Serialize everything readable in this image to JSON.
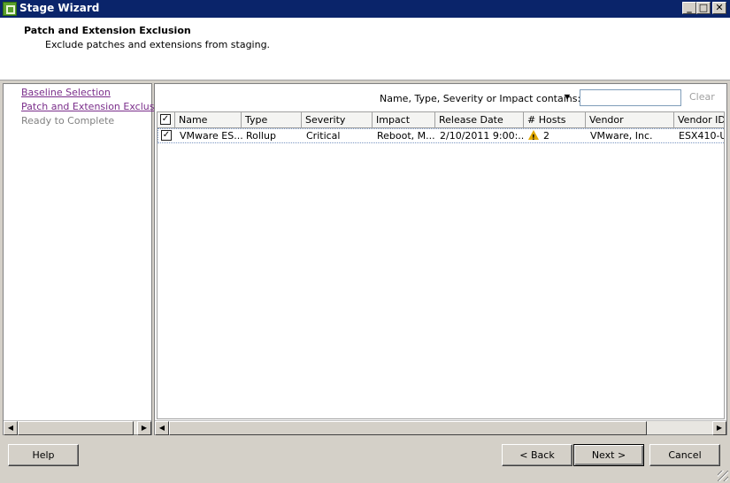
{
  "window": {
    "title": "Stage Wizard",
    "min_glyph": "_",
    "max_glyph": "□",
    "close_glyph": "✕"
  },
  "header": {
    "title": "Patch and Extension Exclusion",
    "subtitle": "Exclude patches and extensions from staging."
  },
  "nav": {
    "items": [
      {
        "label": "Baseline Selection",
        "state": "link"
      },
      {
        "label": "Patch and Extension Exclusion",
        "state": "link"
      },
      {
        "label": "Ready to Complete",
        "state": "disabled"
      }
    ]
  },
  "filter": {
    "label": "Name, Type, Severity or Impact contains:",
    "value": "",
    "clear_label": "Clear"
  },
  "grid": {
    "columns": [
      "Name",
      "Type",
      "Severity",
      "Impact",
      "Release Date",
      "# Hosts",
      "Vendor",
      "Vendor ID"
    ],
    "rows": [
      {
        "checked": true,
        "name": "VMware ES...",
        "type": "Rollup",
        "severity": "Critical",
        "impact": "Reboot, M...",
        "release_date": "2/10/2011 9:00:...",
        "hosts": "2",
        "hosts_icon": "warning-icon",
        "vendor": "VMware, Inc.",
        "vendor_id": "ESX410-U..."
      }
    ]
  },
  "buttons": {
    "help": "Help",
    "back": "< Back",
    "next": "Next >",
    "cancel": "Cancel"
  },
  "colors": {
    "titlebar": "#0a246a",
    "link": "#7a2d8a",
    "warning": "#e0a800"
  }
}
